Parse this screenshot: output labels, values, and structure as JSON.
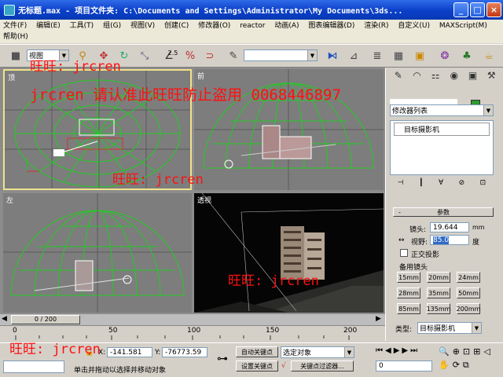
{
  "window": {
    "title": "无标题.max  - 项目文件夹: C:\\Documents and Settings\\Administrator\\My Documents\\3ds...",
    "min": "_",
    "max": "□",
    "close": "×"
  },
  "menu": [
    "文件(F)",
    "编辑(E)",
    "工具(T)",
    "组(G)",
    "视图(V)",
    "创建(C)",
    "修改器(O)",
    "reactor",
    "动画(A)",
    "图表编辑器(D)",
    "渲染(R)",
    "自定义(U)",
    "MAXScript(M)",
    "帮助(H)"
  ],
  "toolbar": {
    "view_combo": "视图",
    "selection_set": "",
    "spinner_label": "2.5"
  },
  "viewports": {
    "top": "顶",
    "front": "前",
    "left": "左",
    "persp": "透视"
  },
  "colors": {
    "wire": "#22cc22",
    "grid": "#5a5a5a",
    "accent": "#f0e38c",
    "red": "#ff1010"
  },
  "cmdpanel": {
    "tab_icons": [
      "arrow-icon",
      "arc-icon",
      "hierarchy-icon",
      "motion-icon",
      "display-icon",
      "utility-icon"
    ],
    "modifier_list": "修改器列表",
    "stack_item": "目标摄影机",
    "rollout_title": "参数",
    "lens_label": "镜头:",
    "lens_value": "19.644",
    "lens_unit": "mm",
    "fov_label": "视野:",
    "fov_value": "85.0",
    "fov_unit": "度",
    "ortho_label": "正交投影",
    "stock_title": "备用镜头",
    "stock_lenses": [
      "15mm",
      "20mm",
      "24mm",
      "28mm",
      "35mm",
      "50mm",
      "85mm",
      "135mm",
      "200mm"
    ],
    "type_label": "类型:",
    "type_value": "目标摄影机"
  },
  "timeline": {
    "frame": "0 / 200",
    "ticks": [
      "0",
      "50",
      "100",
      "150",
      "200"
    ]
  },
  "status": {
    "x_label": "X:",
    "x_value": "-141.581",
    "y_label": "Y:",
    "y_value": "-76773.59",
    "prompt": "单击并拖动以选择并移动对象",
    "autokey": "自动关键点",
    "setkey": "设置关键点",
    "selected": "选定对象",
    "keyfilter": "关键点过滤器...",
    "frame_value": "0"
  },
  "watermarks": [
    {
      "text": "旺旺: jrcren"
    },
    {
      "text": "jrcren 请认准此旺旺防止盗用 0068446897"
    },
    {
      "text": "旺旺: jrcren"
    },
    {
      "text": "旺旺: jrcren"
    },
    {
      "text": "旺旺: jrcren"
    }
  ]
}
